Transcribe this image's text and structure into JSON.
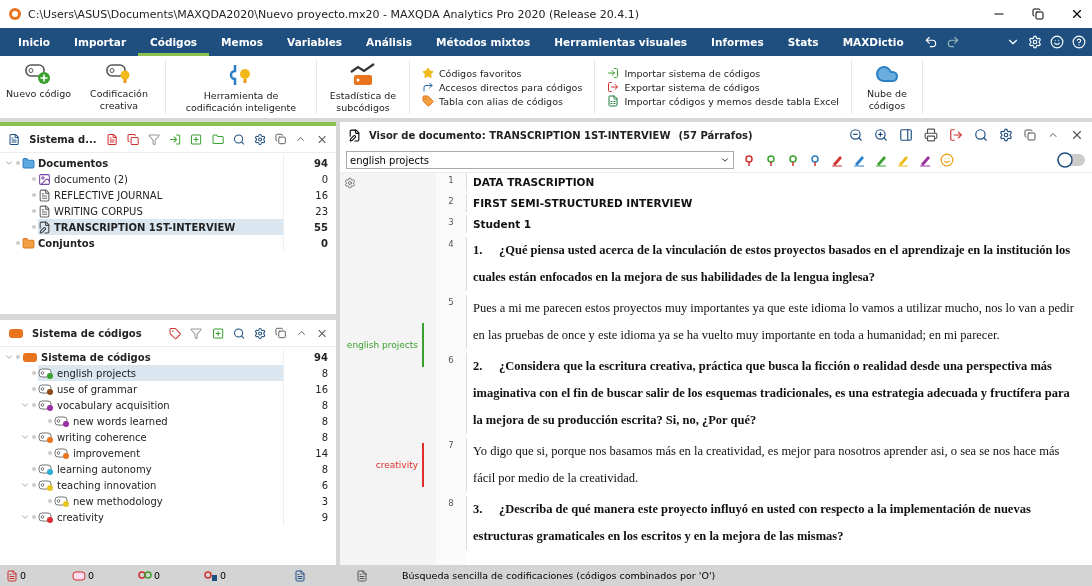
{
  "window": {
    "title": "C:\\Users\\ASUS\\Documents\\MAXQDA2020\\Nuevo proyecto.mx20 - MAXQDA Analytics Pro 2020 (Release 20.4.1)"
  },
  "menu": [
    {
      "label": "Inicio",
      "selected": false
    },
    {
      "label": "Importar",
      "selected": false
    },
    {
      "label": "Códigos",
      "selected": true
    },
    {
      "label": "Memos",
      "selected": false
    },
    {
      "label": "Variables",
      "selected": false
    },
    {
      "label": "Análisis",
      "selected": false
    },
    {
      "label": "Métodos mixtos",
      "selected": false
    },
    {
      "label": "Herramientas visuales",
      "selected": false
    },
    {
      "label": "Informes",
      "selected": false
    },
    {
      "label": "Stats",
      "selected": false
    },
    {
      "label": "MAXDictio",
      "selected": false
    }
  ],
  "ribbon": {
    "big": [
      {
        "kind": "new",
        "label": "Nuevo código"
      },
      {
        "kind": "creative",
        "label": "Codificación creativa"
      },
      {
        "kind": "smart",
        "label": "Herramienta de codificación inteligente"
      },
      {
        "kind": "stats",
        "label": "Estadística de subcódigos"
      }
    ],
    "list1": [
      {
        "kind": "star",
        "label": "Códigos favoritos"
      },
      {
        "kind": "arrow",
        "label": "Accesos directos para códigos"
      },
      {
        "kind": "tag",
        "label": "Tabla con alias de códigos"
      }
    ],
    "list2": [
      {
        "kind": "import",
        "label": "Importar sistema de códigos"
      },
      {
        "kind": "export",
        "label": "Exportar sistema de códigos"
      },
      {
        "kind": "excel",
        "label": "Importar códigos y memos desde tabla Excel"
      }
    ],
    "cloud": {
      "label": "Nube de códigos"
    }
  },
  "documents": {
    "title": "Sistema d...",
    "items": [
      {
        "label": "Documentos",
        "count": "94",
        "kind": "folder",
        "bold": true,
        "selected": false,
        "expanded": true,
        "children": [
          {
            "label": "documento (2)",
            "count": "0",
            "kind": "image",
            "bold": false,
            "selected": false
          },
          {
            "label": "REFLECTIVE JOURNAL",
            "count": "16",
            "kind": "text",
            "bold": false,
            "selected": false
          },
          {
            "label": "WRITING CORPUS",
            "count": "23",
            "kind": "text",
            "bold": false,
            "selected": false
          },
          {
            "label": "TRANSCRIPTION 1ST-INTERVIEW",
            "count": "55",
            "kind": "edit",
            "bold": true,
            "selected": true
          }
        ]
      },
      {
        "label": "Conjuntos",
        "count": "0",
        "kind": "set",
        "bold": true,
        "selected": false
      }
    ]
  },
  "codes": {
    "title": "Sistema de códigos",
    "root": {
      "label": "Sistema de códigos",
      "count": "94",
      "expanded": true
    },
    "items": [
      {
        "label": "english projects",
        "count": "8",
        "color": "#3aa02e",
        "selected": true
      },
      {
        "label": "use of grammar",
        "count": "16",
        "color": "#8a4a1c",
        "selected": false
      },
      {
        "label": "vocabulary acquisition",
        "count": "8",
        "color": "#9b2ea0",
        "selected": false,
        "expanded": true,
        "children": [
          {
            "label": "new words learned",
            "count": "8",
            "color": "#9b2ea0",
            "selected": false
          }
        ]
      },
      {
        "label": "writing coherence",
        "count": "8",
        "color": "#e8741e",
        "selected": false,
        "expanded": true,
        "children": [
          {
            "label": "improvement",
            "count": "14",
            "color": "#e8741e",
            "selected": false
          }
        ]
      },
      {
        "label": "learning autonomy",
        "count": "8",
        "color": "#2aaed6",
        "selected": false
      },
      {
        "label": "teaching innovation",
        "count": "6",
        "color": "#e8c41e",
        "selected": false,
        "expanded": true,
        "children": [
          {
            "label": "new methodology",
            "count": "3",
            "color": "#e8c41e",
            "selected": false
          }
        ]
      },
      {
        "label": "creativity",
        "count": "9",
        "color": "#e02e2e",
        "selected": false,
        "expanded": true
      }
    ]
  },
  "viewer": {
    "title": "Visor de documento: TRANSCRIPTION 1ST-INTERVIEW",
    "paragraphs_count": "(57 Párrafos)",
    "code_select": "english projects",
    "paragraphs": [
      {
        "n": "1",
        "kind": "heading",
        "text": "DATA TRASCRIPTION"
      },
      {
        "n": "2",
        "kind": "heading",
        "text": "FIRST SEMI-STRUCTURED INTERVIEW"
      },
      {
        "n": "3",
        "kind": "heading",
        "text": "Student 1"
      },
      {
        "n": "4",
        "kind": "question",
        "num": "1.",
        "text": "¿Qué piensa usted acerca de la vinculación de estos proyectos basados en el aprendizaje en la institución los cuales están enfocados en la mejora de sus habilidades de la lengua inglesa?"
      },
      {
        "n": "5",
        "kind": "answer",
        "text": "Pues a mi me parecen estos proyectos muy importantes ya que este idioma lo vamos a utilizar mucho, nos lo van a pedir en las pruebas de once y este idioma ya se ha vuelto muy importante en toda a humanidad; en mi parecer.",
        "code": {
          "label": "english projects",
          "color": "#3aa02e"
        }
      },
      {
        "n": "6",
        "kind": "question",
        "num": "2.",
        "text": "¿Considera que la escritura creativa, práctica que busca la ficción o realidad desde una perspectiva más imaginativa con el fin de buscar salir de los esquemas tradicionales, es una estrategia adecuada y fructífera para la mejora de su producción escrita? Si, no, ¿Por qué?"
      },
      {
        "n": "7",
        "kind": "answer",
        "text": "Yo digo que si, porque nos basamos más en la creatividad, es mejor para nosotros aprender asi, o sea se nos hace más fácil por medio de la creatividad.",
        "code": {
          "label": "creativity",
          "color": "#e02e2e"
        }
      },
      {
        "n": "8",
        "kind": "question",
        "num": "3.",
        "text": "¿Describa de qué manera este proyecto influyó en usted con respecto a la implementación de nuevas estructuras gramaticales en los escritos y en la mejora de las mismas?"
      }
    ]
  },
  "status": {
    "counts": [
      {
        "kind": "doc",
        "value": "0"
      },
      {
        "kind": "code",
        "value": "0"
      },
      {
        "kind": "multi",
        "value": "0"
      },
      {
        "kind": "user",
        "value": "0"
      }
    ],
    "message": "Búsqueda sencilla de codificaciones (códigos combinados por 'O')"
  }
}
